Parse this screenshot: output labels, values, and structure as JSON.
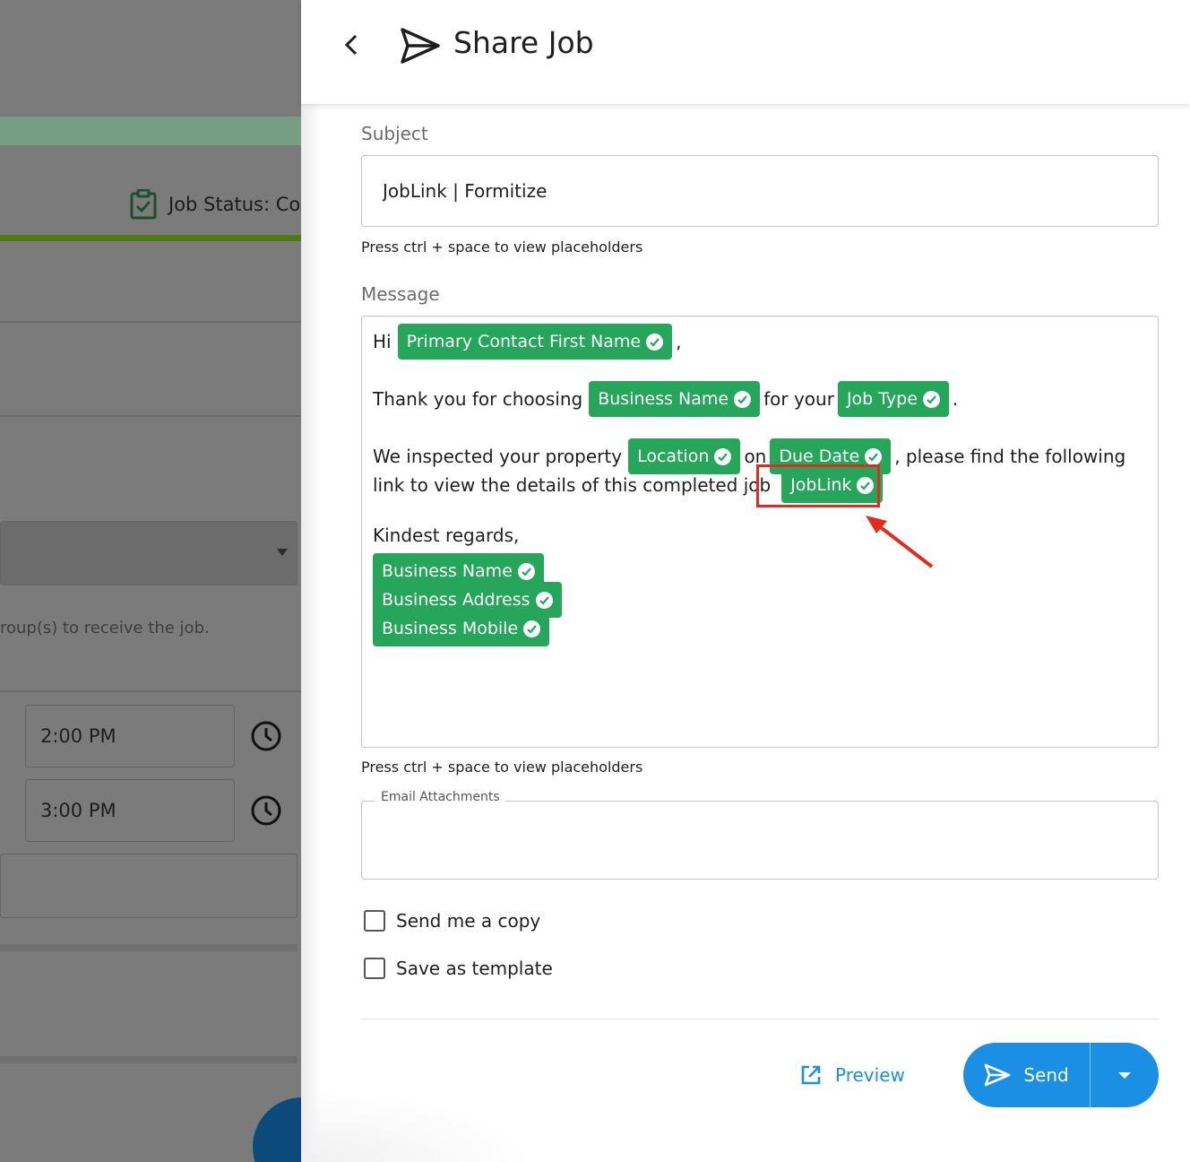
{
  "background": {
    "job_status": "Job Status: Co",
    "hint_text": "roup(s) to receive the job.",
    "time_start": "2:00 PM",
    "time_end": "3:00 PM"
  },
  "drawer": {
    "title": "Share Job",
    "header_icon": "paper-plane-icon",
    "back_icon": "chevron-left-icon"
  },
  "subject": {
    "label": "Subject",
    "value": "JobLink | Formitize",
    "helper": "Press ctrl + space to view placeholders"
  },
  "message": {
    "label": "Message",
    "helper": "Press ctrl + space to view placeholders",
    "line1": {
      "prefix": "Hi",
      "chip": "Primary Contact First Name",
      "suffix": ","
    },
    "line2": {
      "prefix": "Thank you for choosing",
      "chip1": "Business Name",
      "middle": "for your",
      "chip2": "Job Type",
      "suffix": "."
    },
    "line3": {
      "prefix": "We inspected your property",
      "chip1": "Location",
      "middle": "on",
      "chip2": "Due Date",
      "suffix": ", please find the following"
    },
    "line4": {
      "prefix": "link to view the details of this completed job",
      "chip": "JobLink"
    },
    "closing": "Kindest regards,",
    "signature": [
      "Business Name",
      "Business Address",
      "Business Mobile"
    ]
  },
  "attachments": {
    "legend": "Email Attachments"
  },
  "options": {
    "send_copy": {
      "label": "Send me a copy",
      "checked": false
    },
    "save_template": {
      "label": "Save as template",
      "checked": false
    }
  },
  "actions": {
    "preview_label": "Preview",
    "send_label": "Send",
    "accent_color": "#1a8fe3"
  },
  "colors": {
    "chip": "#26a65a",
    "highlight": "#e32a1c"
  }
}
